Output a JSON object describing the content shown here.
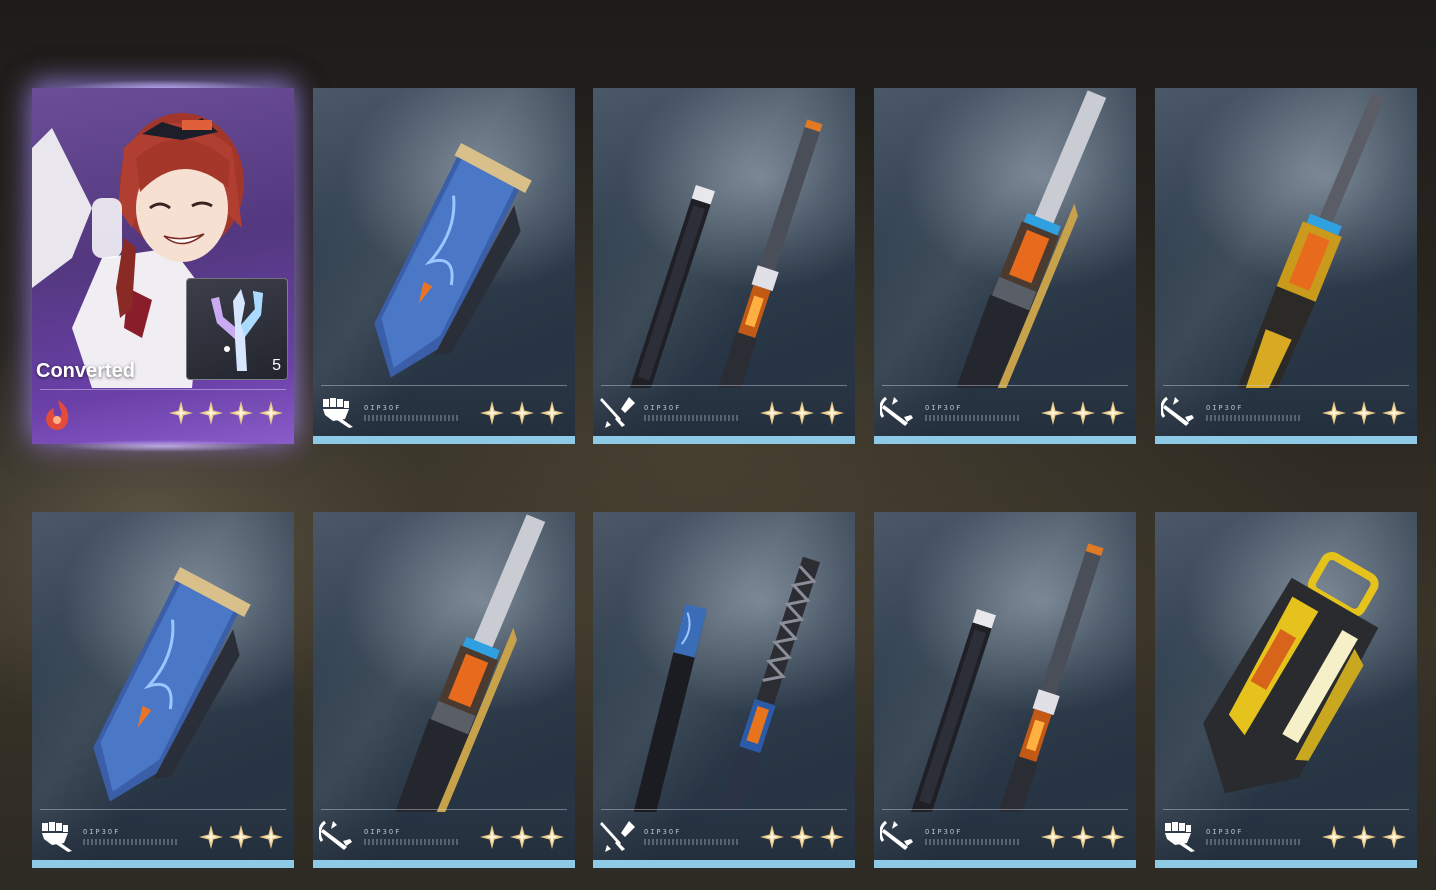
{
  "featured": {
    "status_label": "Converted",
    "item_count": "5",
    "element_icon": "fire-element-icon",
    "item_icon": "coral-crystal-icon",
    "rarity_stars": 4
  },
  "cards": [
    {
      "weapon": "blue-gauntlet",
      "type_icon": "gauntlet-type-icon",
      "code": "OIP3OF",
      "rarity_stars": 3
    },
    {
      "weapon": "dual-blades",
      "type_icon": "dual-blades-type-icon",
      "code": "OIP3OF",
      "rarity_stars": 3
    },
    {
      "weapon": "broadsword",
      "type_icon": "broadsword-type-icon",
      "code": "OIP3OF",
      "rarity_stars": 3
    },
    {
      "weapon": "gold-broadsword",
      "type_icon": "broadsword-type-icon",
      "code": "OIP3OF",
      "rarity_stars": 3
    },
    {
      "weapon": "blue-gauntlet",
      "type_icon": "gauntlet-type-icon",
      "code": "OIP3OF",
      "rarity_stars": 3
    },
    {
      "weapon": "broadsword",
      "type_icon": "broadsword-type-icon",
      "code": "OIP3OF",
      "rarity_stars": 3
    },
    {
      "weapon": "dual-blades-blue",
      "type_icon": "dual-blades-type-icon",
      "code": "OIP3OF",
      "rarity_stars": 3
    },
    {
      "weapon": "dual-blades",
      "type_icon": "broadsword-type-icon",
      "code": "OIP3OF",
      "rarity_stars": 3
    },
    {
      "weapon": "gold-gauntlet",
      "type_icon": "gauntlet-type-icon",
      "code": "OIP3OF",
      "rarity_stars": 3
    }
  ],
  "colors": {
    "rarity_bar": "#8ec9e6",
    "star_gold": "#e9c98a",
    "featured_purple": "#6a40a8"
  }
}
